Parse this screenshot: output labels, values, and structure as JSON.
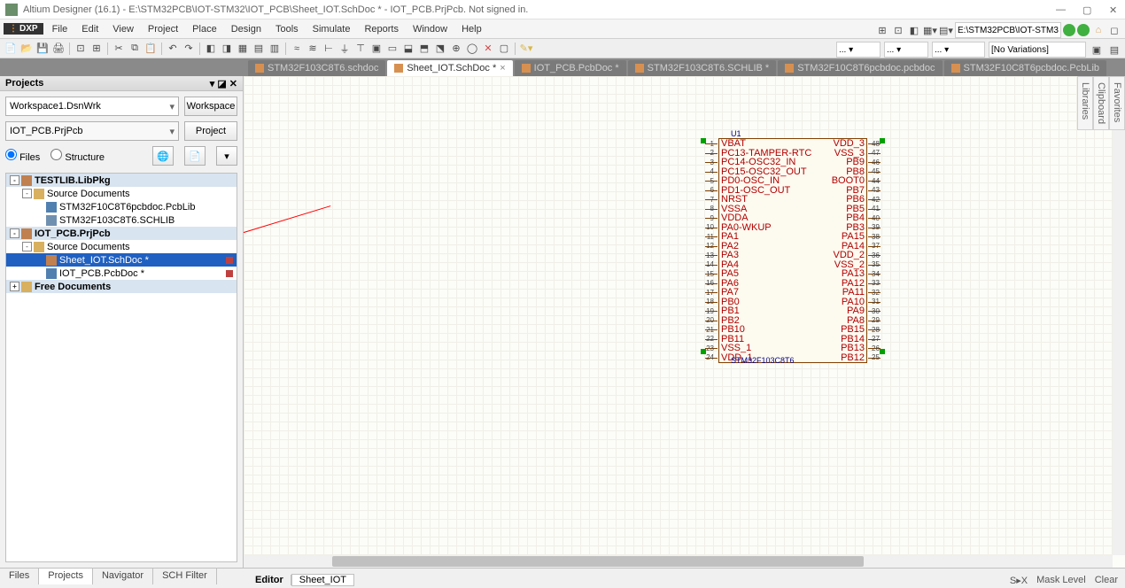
{
  "title": "Altium Designer (16.1) - E:\\STM32PCB\\IOT-STM32\\IOT_PCB\\Sheet_IOT.SchDoc * - IOT_PCB.PrjPcb. Not signed in.",
  "menu": [
    "File",
    "Edit",
    "View",
    "Project",
    "Place",
    "Design",
    "Tools",
    "Simulate",
    "Reports",
    "Window",
    "Help"
  ],
  "dxp": "DXP",
  "path_box": "E:\\STM32PCB\\IOT-STM3",
  "variations": "[No Variations]",
  "doctabs": [
    {
      "label": "STM32F103C8T6.schdoc",
      "active": false
    },
    {
      "label": "Sheet_IOT.SchDoc *",
      "active": true
    },
    {
      "label": "IOT_PCB.PcbDoc *",
      "active": false
    },
    {
      "label": "STM32F103C8T6.SCHLIB *",
      "active": false
    },
    {
      "label": "STM32F10C8T6pcbdoc.pcbdoc",
      "active": false
    },
    {
      "label": "STM32F10C8T6pcbdoc.PcbLib",
      "active": false
    }
  ],
  "projects": {
    "title": "Projects",
    "workspace": "Workspace1.DsnWrk",
    "workspace_btn": "Workspace",
    "project_file": "IOT_PCB.PrjPcb",
    "project_btn": "Project",
    "radio_files": "Files",
    "radio_structure": "Structure",
    "tree": [
      {
        "depth": 0,
        "toggle": "-",
        "icon": "ti-file",
        "label": "TESTLIB.LibPkg",
        "bold": true
      },
      {
        "depth": 1,
        "toggle": "-",
        "icon": "ti-folder",
        "label": "Source Documents"
      },
      {
        "depth": 2,
        "toggle": "",
        "icon": "ti-pcb",
        "label": "STM32F10C8T6pcbdoc.PcbLib"
      },
      {
        "depth": 2,
        "toggle": "",
        "icon": "ti-lib",
        "label": "STM32F103C8T6.SCHLIB"
      },
      {
        "depth": 0,
        "toggle": "-",
        "icon": "ti-file",
        "label": "IOT_PCB.PrjPcb",
        "bold": true,
        "highlight": true
      },
      {
        "depth": 1,
        "toggle": "-",
        "icon": "ti-folder",
        "label": "Source Documents"
      },
      {
        "depth": 2,
        "toggle": "",
        "icon": "ti-file",
        "label": "Sheet_IOT.SchDoc *",
        "selected": true,
        "ind": "#c04040"
      },
      {
        "depth": 2,
        "toggle": "",
        "icon": "ti-pcb",
        "label": "IOT_PCB.PcbDoc *",
        "ind": "#c04040"
      },
      {
        "depth": 0,
        "toggle": "+",
        "icon": "ti-folder",
        "label": "Free Documents",
        "bold": true
      }
    ]
  },
  "chip": {
    "ref": "U1",
    "part": "STM32F103C8T6",
    "pins_left": [
      {
        "n": "1",
        "name": "VBAT"
      },
      {
        "n": "2",
        "name": "PC13-TAMPER-RTC"
      },
      {
        "n": "3",
        "name": "PC14-OSC32_IN"
      },
      {
        "n": "4",
        "name": "PC15-OSC32_OUT"
      },
      {
        "n": "5",
        "name": "PD0-OSC_IN"
      },
      {
        "n": "6",
        "name": "PD1-OSC_OUT"
      },
      {
        "n": "7",
        "name": "NRST"
      },
      {
        "n": "8",
        "name": "VSSA"
      },
      {
        "n": "9",
        "name": "VDDA"
      },
      {
        "n": "10",
        "name": "PA0-WKUP"
      },
      {
        "n": "11",
        "name": "PA1"
      },
      {
        "n": "12",
        "name": "PA2"
      },
      {
        "n": "13",
        "name": "PA3"
      },
      {
        "n": "14",
        "name": "PA4"
      },
      {
        "n": "15",
        "name": "PA5"
      },
      {
        "n": "16",
        "name": "PA6"
      },
      {
        "n": "17",
        "name": "PA7"
      },
      {
        "n": "18",
        "name": "PB0"
      },
      {
        "n": "19",
        "name": "PB1"
      },
      {
        "n": "20",
        "name": "PB2"
      },
      {
        "n": "21",
        "name": "PB10"
      },
      {
        "n": "22",
        "name": "PB11"
      },
      {
        "n": "23",
        "name": "VSS_1"
      },
      {
        "n": "24",
        "name": "VDD_1"
      }
    ],
    "pins_right": [
      {
        "n": "48",
        "name": "VDD_3"
      },
      {
        "n": "47",
        "name": "VSS_3"
      },
      {
        "n": "46",
        "name": "PB9"
      },
      {
        "n": "45",
        "name": "PB8"
      },
      {
        "n": "44",
        "name": "BOOT0"
      },
      {
        "n": "43",
        "name": "PB7"
      },
      {
        "n": "42",
        "name": "PB6"
      },
      {
        "n": "41",
        "name": "PB5"
      },
      {
        "n": "40",
        "name": "PB4"
      },
      {
        "n": "39",
        "name": "PB3"
      },
      {
        "n": "38",
        "name": "PA15"
      },
      {
        "n": "37",
        "name": "PA14"
      },
      {
        "n": "36",
        "name": "VDD_2"
      },
      {
        "n": "35",
        "name": "VSS_2"
      },
      {
        "n": "34",
        "name": "PA13"
      },
      {
        "n": "33",
        "name": "PA12"
      },
      {
        "n": "32",
        "name": "PA11"
      },
      {
        "n": "31",
        "name": "PA10"
      },
      {
        "n": "30",
        "name": "PA9"
      },
      {
        "n": "29",
        "name": "PA8"
      },
      {
        "n": "28",
        "name": "PB15"
      },
      {
        "n": "27",
        "name": "PB14"
      },
      {
        "n": "26",
        "name": "PB13"
      },
      {
        "n": "25",
        "name": "PB12"
      }
    ]
  },
  "bottom_tabs": [
    "Files",
    "Projects",
    "Navigator",
    "SCH Filter"
  ],
  "editor": {
    "label": "Editor",
    "sheet": "Sheet_IOT"
  },
  "status_right": [
    "S▸X",
    "Mask Level",
    "Clear"
  ],
  "right_panels": [
    "Favorites",
    "Clipboard",
    "Libraries"
  ]
}
